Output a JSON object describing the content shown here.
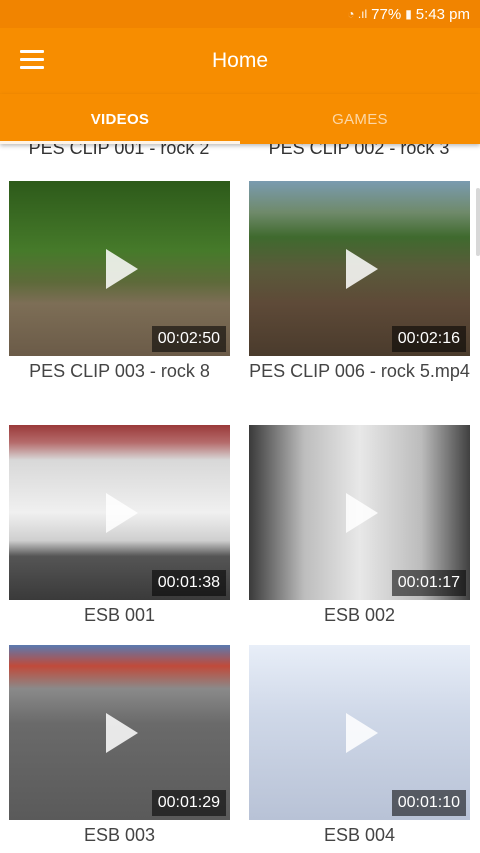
{
  "status_bar": {
    "signal": "◔ .ıl",
    "battery_pct": "77%",
    "battery_icon": "▮",
    "time": "5:43 pm"
  },
  "app_bar": {
    "title": "Home"
  },
  "tabs": [
    {
      "label": "VIDEOS",
      "active": true
    },
    {
      "label": "GAMES",
      "active": false
    }
  ],
  "peek_row": [
    "PES CLIP 001 - rock 2",
    "PES CLIP 002 - rock 3"
  ],
  "videos": [
    {
      "title": "PES CLIP 003 - rock 8",
      "duration": "00:02:50"
    },
    {
      "title": "PES CLIP 006 - rock 5.mp4",
      "duration": "00:02:16"
    },
    {
      "title": "ESB 001",
      "duration": "00:01:38"
    },
    {
      "title": "ESB 002",
      "duration": "00:01:17"
    },
    {
      "title": "ESB 003",
      "duration": "00:01:29"
    },
    {
      "title": "ESB 004",
      "duration": "00:01:10"
    }
  ],
  "colors": {
    "primary": "#f78d00",
    "status_bar": "#f18400"
  }
}
